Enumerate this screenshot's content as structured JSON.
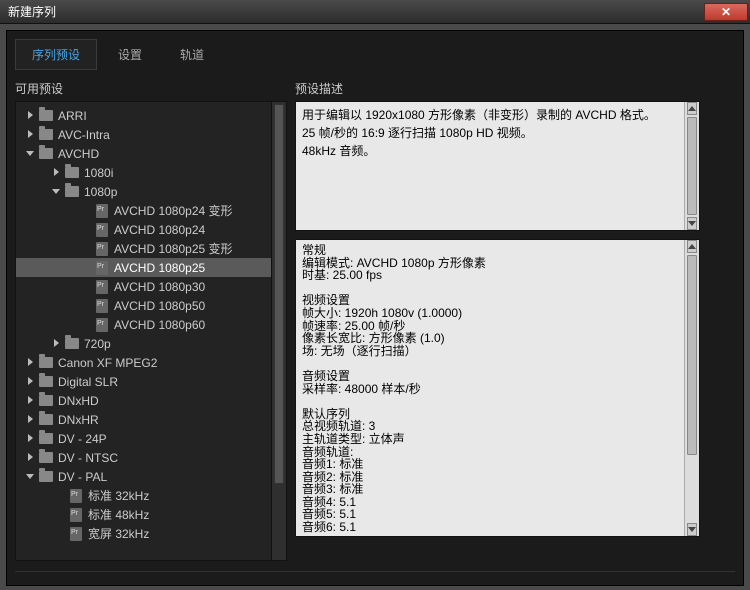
{
  "window": {
    "title": "新建序列"
  },
  "tabs": [
    {
      "label": "序列预设",
      "active": true
    },
    {
      "label": "设置",
      "active": false
    },
    {
      "label": "轨道",
      "active": false
    }
  ],
  "left": {
    "label": "可用预设",
    "tree": [
      {
        "type": "folder",
        "label": "ARRI",
        "depth": 0,
        "expanded": false
      },
      {
        "type": "folder",
        "label": "AVC-Intra",
        "depth": 0,
        "expanded": false
      },
      {
        "type": "folder",
        "label": "AVCHD",
        "depth": 0,
        "expanded": true
      },
      {
        "type": "folder",
        "label": "1080i",
        "depth": 1,
        "expanded": false
      },
      {
        "type": "folder",
        "label": "1080p",
        "depth": 1,
        "expanded": true
      },
      {
        "type": "preset",
        "label": "AVCHD 1080p24 变形",
        "depth": 2,
        "selected": false
      },
      {
        "type": "preset",
        "label": "AVCHD 1080p24",
        "depth": 2,
        "selected": false
      },
      {
        "type": "preset",
        "label": "AVCHD 1080p25 变形",
        "depth": 2,
        "selected": false
      },
      {
        "type": "preset",
        "label": "AVCHD 1080p25",
        "depth": 2,
        "selected": true
      },
      {
        "type": "preset",
        "label": "AVCHD 1080p30",
        "depth": 2,
        "selected": false
      },
      {
        "type": "preset",
        "label": "AVCHD 1080p50",
        "depth": 2,
        "selected": false
      },
      {
        "type": "preset",
        "label": "AVCHD 1080p60",
        "depth": 2,
        "selected": false
      },
      {
        "type": "folder",
        "label": "720p",
        "depth": 1,
        "expanded": false
      },
      {
        "type": "folder",
        "label": "Canon XF MPEG2",
        "depth": 0,
        "expanded": false
      },
      {
        "type": "folder",
        "label": "Digital SLR",
        "depth": 0,
        "expanded": false
      },
      {
        "type": "folder",
        "label": "DNxHD",
        "depth": 0,
        "expanded": false
      },
      {
        "type": "folder",
        "label": "DNxHR",
        "depth": 0,
        "expanded": false
      },
      {
        "type": "folder",
        "label": "DV - 24P",
        "depth": 0,
        "expanded": false
      },
      {
        "type": "folder",
        "label": "DV - NTSC",
        "depth": 0,
        "expanded": false
      },
      {
        "type": "folder",
        "label": "DV - PAL",
        "depth": 0,
        "expanded": true
      },
      {
        "type": "preset",
        "label": "标准 32kHz",
        "depth": 1,
        "selected": false
      },
      {
        "type": "preset",
        "label": "标准 48kHz",
        "depth": 1,
        "selected": false
      },
      {
        "type": "preset",
        "label": "宽屏 32kHz",
        "depth": 1,
        "selected": false
      }
    ]
  },
  "right": {
    "label": "预设描述",
    "description": [
      "用于编辑以 1920x1080 方形像素（非变形）录制的 AVCHD 格式。",
      "25 帧/秒的 16:9 逐行扫描 1080p HD 视频。",
      "48kHz 音频。"
    ],
    "details": [
      "常规",
      "编辑模式: AVCHD 1080p 方形像素",
      "时基: 25.00 fps",
      "",
      "视频设置",
      "帧大小: 1920h 1080v (1.0000)",
      "帧速率: 25.00 帧/秒",
      "像素长宽比: 方形像素 (1.0)",
      "场: 无场（逐行扫描）",
      "",
      "音频设置",
      "采样率: 48000 样本/秒",
      "",
      "默认序列",
      "总视频轨道: 3",
      "主轨道类型: 立体声",
      "音频轨道:",
      "音频1: 标准",
      "音频2: 标准",
      "音频3: 标准",
      "音频4: 5.1",
      "音频5: 5.1",
      "音频6: 5.1"
    ]
  }
}
